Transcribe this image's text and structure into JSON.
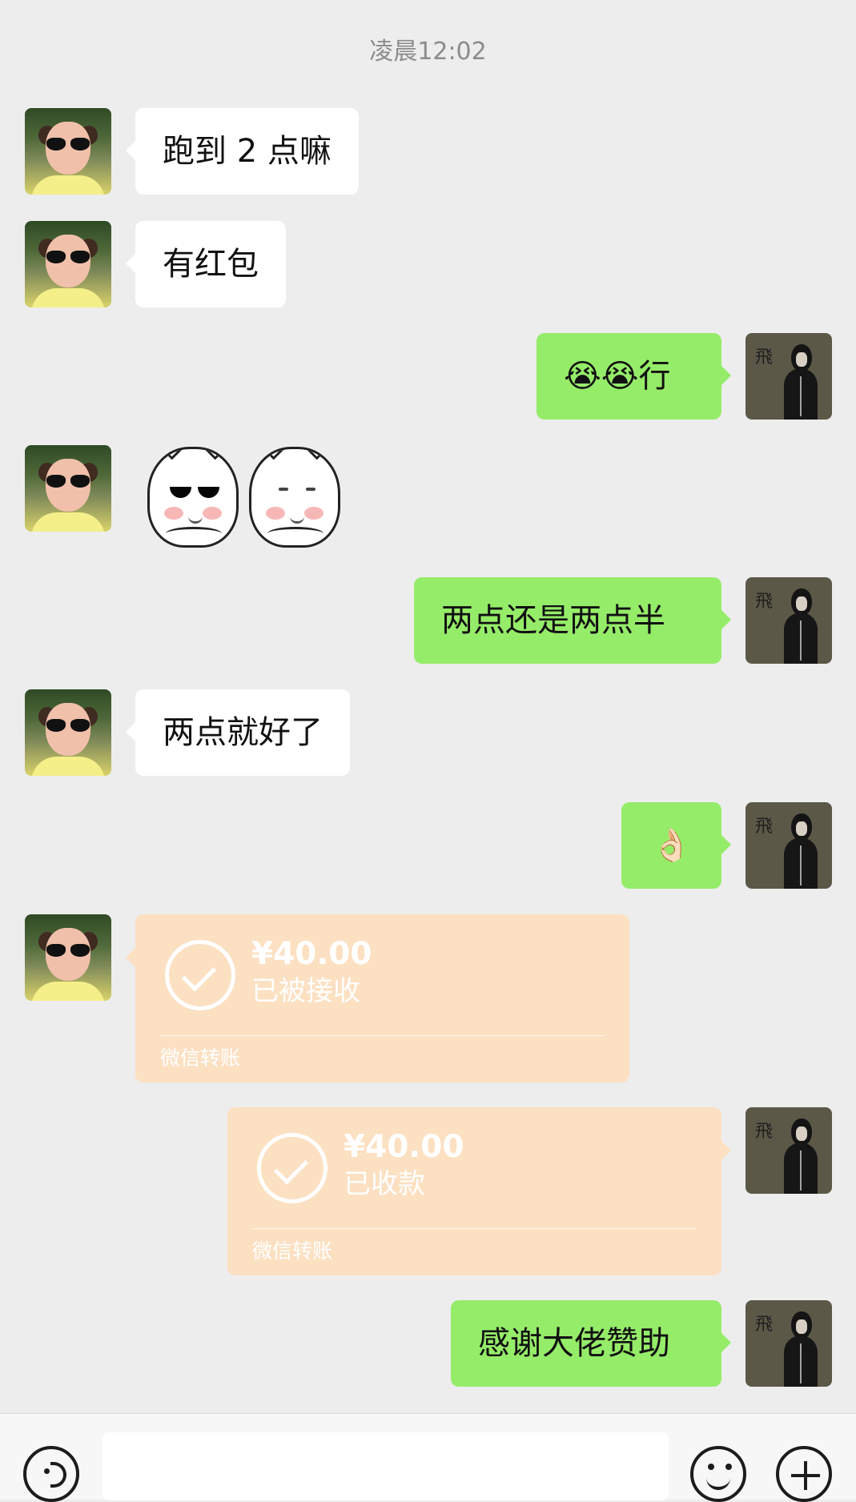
{
  "timestamp": "凌晨12:02",
  "messages": {
    "m1": "跑到 2 点嘛",
    "m2": "有红包",
    "m3": "😭😭行",
    "m5": "两点还是两点半",
    "m6": "两点就好了",
    "m7": "👌🏻",
    "m10": "感谢大佬赞助"
  },
  "transfers": {
    "received": {
      "amount": "¥40.00",
      "status": "已被接收",
      "footer": "微信转账"
    },
    "collected": {
      "amount": "¥40.00",
      "status": "已收款",
      "footer": "微信转账"
    }
  },
  "avatars": {
    "right_avatar_glyph": "飛"
  },
  "icons": {
    "voice": "voice-icon",
    "emoji": "emoji-icon",
    "more": "plus-icon"
  },
  "colors": {
    "chat_background": "#ededed",
    "incoming_bubble": "#ffffff",
    "outgoing_bubble": "#95ec69",
    "transfer_card": "#fce0c2",
    "input_bar": "#f7f7f7"
  }
}
